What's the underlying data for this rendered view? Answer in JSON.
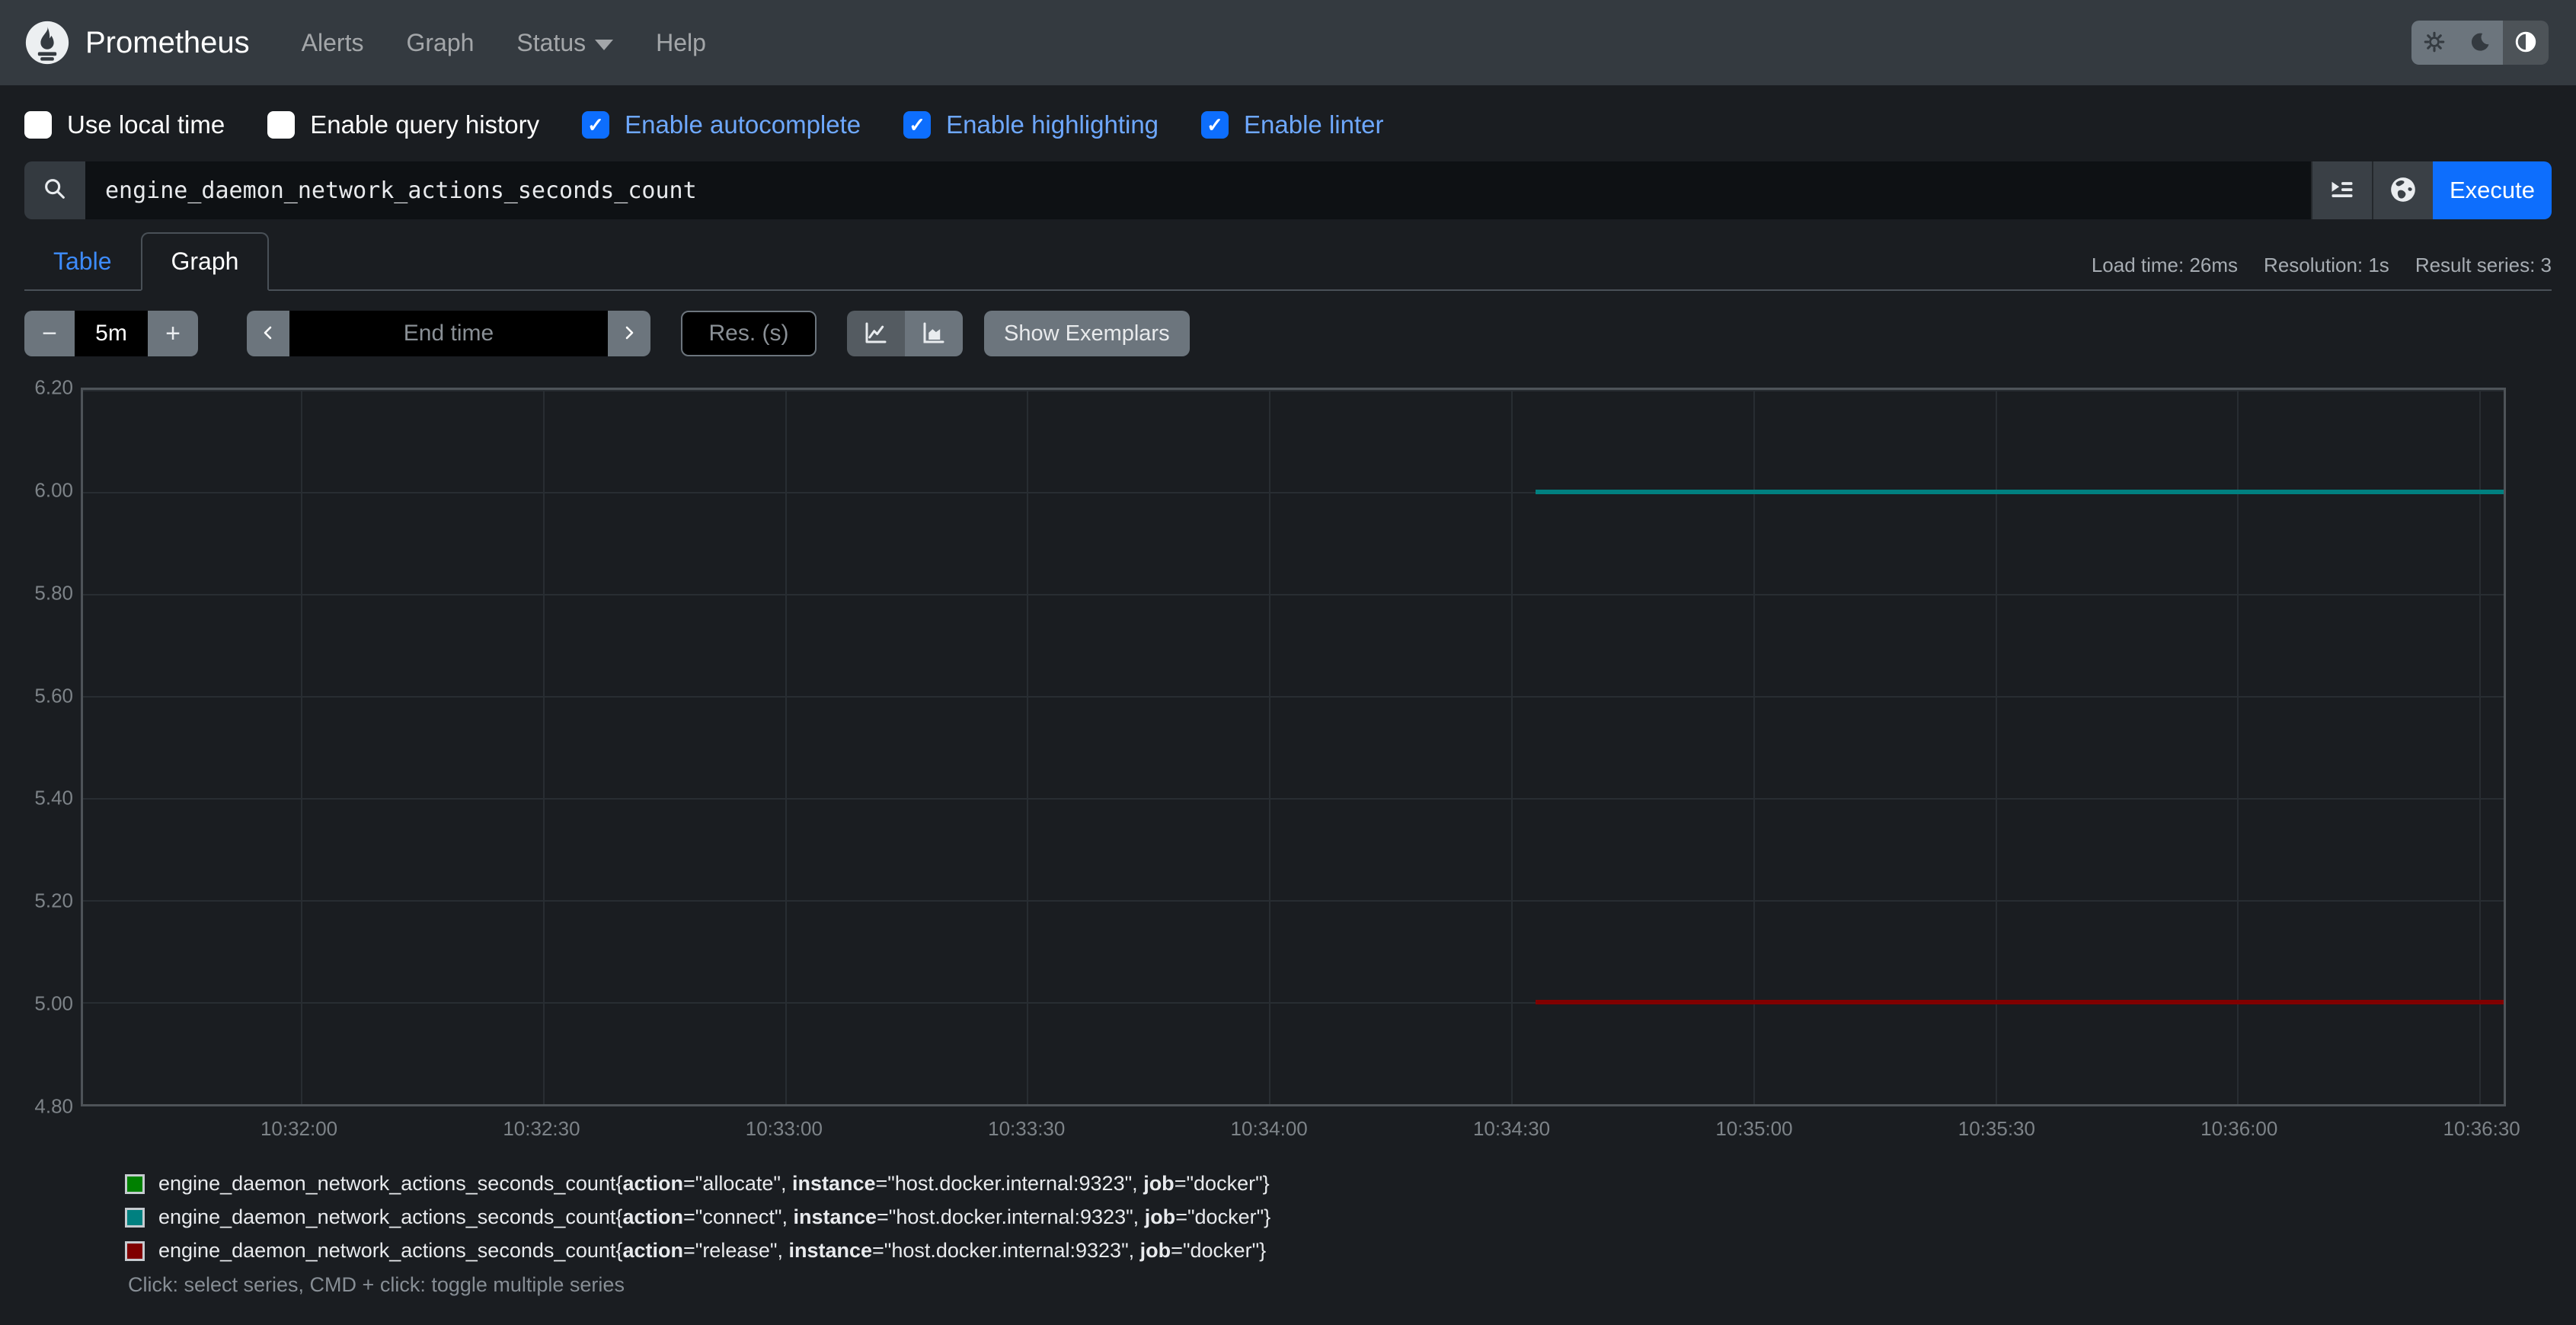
{
  "navbar": {
    "brand": "Prometheus",
    "links": [
      "Alerts",
      "Graph",
      "Status",
      "Help"
    ],
    "theme_buttons": [
      "light",
      "dark",
      "auto"
    ]
  },
  "options": [
    {
      "label": "Use local time",
      "checked": false
    },
    {
      "label": "Enable query history",
      "checked": false
    },
    {
      "label": "Enable autocomplete",
      "checked": true
    },
    {
      "label": "Enable highlighting",
      "checked": true
    },
    {
      "label": "Enable linter",
      "checked": true
    }
  ],
  "query": {
    "value": "engine_daemon_network_actions_seconds_count",
    "execute_label": "Execute"
  },
  "tabs": [
    {
      "label": "Table",
      "active": false
    },
    {
      "label": "Graph",
      "active": true
    }
  ],
  "stats": {
    "load_time": "Load time: 26ms",
    "resolution": "Resolution: 1s",
    "result_series": "Result series: 3"
  },
  "controls": {
    "decrease": "−",
    "range_value": "5m",
    "increase": "+",
    "end_time_placeholder": "End time",
    "resolution_placeholder": "Res. (s)",
    "show_exemplars": "Show Exemplars"
  },
  "chart_data": {
    "type": "line",
    "title": "",
    "xlabel": "",
    "ylabel": "",
    "grid": true,
    "legend_position": "bottom",
    "x_start": "10:31:33",
    "x_end": "10:36:33",
    "xticks": [
      "10:32:00",
      "10:32:30",
      "10:33:00",
      "10:33:30",
      "10:34:00",
      "10:34:30",
      "10:35:00",
      "10:35:30",
      "10:36:00",
      "10:36:30"
    ],
    "ylim": [
      4.8,
      6.2
    ],
    "yticks": [
      "6.20",
      "6.00",
      "5.80",
      "5.60",
      "5.40",
      "5.20",
      "5.00",
      "4.80"
    ],
    "series": [
      {
        "name": "engine_daemon_network_actions_seconds_count{action=\"allocate\", instance=\"host.docker.internal:9323\", job=\"docker\"}",
        "action": "allocate",
        "color": "#008000",
        "value": 6.0,
        "x_from": "10:34:33",
        "x_to": "10:36:33"
      },
      {
        "name": "engine_daemon_network_actions_seconds_count{action=\"connect\", instance=\"host.docker.internal:9323\", job=\"docker\"}",
        "action": "connect",
        "color": "#008080",
        "value": 6.0,
        "x_from": "10:34:33",
        "x_to": "10:36:33"
      },
      {
        "name": "engine_daemon_network_actions_seconds_count{action=\"release\", instance=\"host.docker.internal:9323\", job=\"docker\"}",
        "action": "release",
        "color": "#800000",
        "value": 5.0,
        "x_from": "10:34:33",
        "x_to": "10:36:33"
      }
    ]
  },
  "legend_note": "Click: select series, CMD + click: toggle multiple series",
  "colors": {
    "accent_blue": "#0d6efd",
    "checked_label_blue": "#6ea8fe",
    "tab_link_blue": "#3d8bfd",
    "navbar_bg": "#343a40",
    "body_bg": "#1a1d21",
    "plot_border": "#4e5358",
    "grid_line": "#282d32"
  }
}
